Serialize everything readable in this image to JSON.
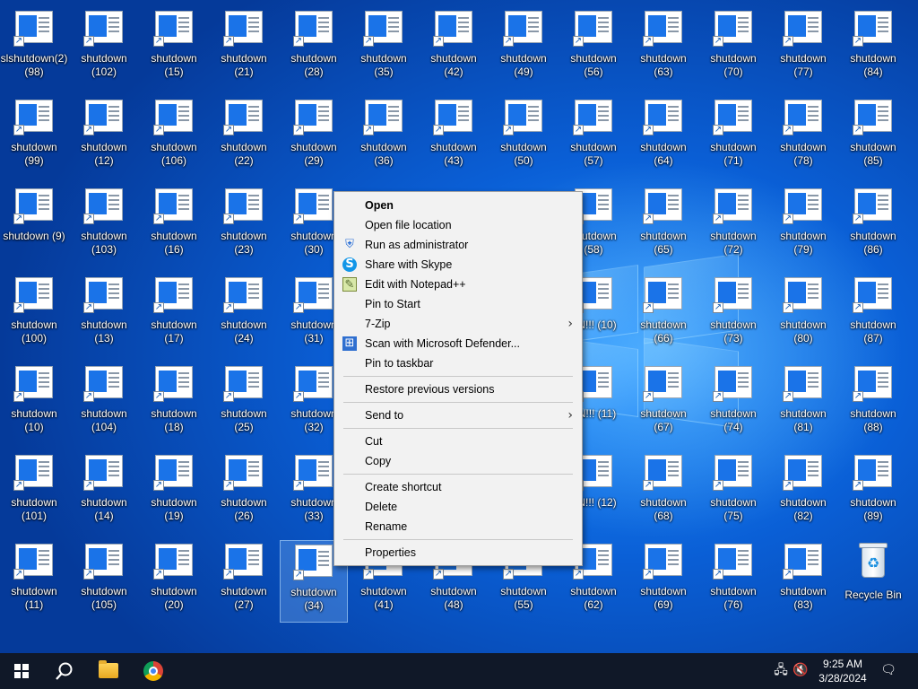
{
  "desktop": {
    "icon_label_base": "shutdown",
    "columns": [
      [
        "(98)",
        "(99)",
        "(9)",
        "(100)",
        "(10)",
        "(101)",
        "(11)"
      ],
      [
        "(102)",
        "(12)",
        "(103)",
        "(13)",
        "(104)",
        "(14)",
        "(105)"
      ],
      [
        "(15)",
        "(106)",
        "(16)",
        "(17)",
        "(18)",
        "(19)",
        "(20)"
      ],
      [
        "(21)",
        "(22)",
        "(23)",
        "(24)",
        "(25)",
        "(26)",
        "(27)"
      ],
      [
        "(28)",
        "(29)",
        "(30)",
        "(31)",
        "(32)",
        "(33)",
        "(34)"
      ],
      [
        "(35)",
        "(36)",
        "",
        "",
        "",
        "",
        "(41)"
      ],
      [
        "(42)",
        "(43)",
        "",
        "",
        "",
        "",
        "(48)"
      ],
      [
        "(49)",
        "(50)",
        "",
        "",
        "",
        "",
        "(55)"
      ],
      [
        "(56)",
        "(57)",
        "(58)",
        "EN!!! (10)",
        "EN!!! (11)",
        "EN!!! (12)",
        "(62)"
      ],
      [
        "(63)",
        "(64)",
        "(65)",
        "(66)",
        "(67)",
        "(68)",
        "(69)"
      ],
      [
        "(70)",
        "(71)",
        "(72)",
        "(73)",
        "(74)",
        "(75)",
        "(76)"
      ],
      [
        "(77)",
        "(78)",
        "(79)",
        "(80)",
        "(81)",
        "(82)",
        "(83)"
      ],
      [
        "(84)",
        "(85)",
        "(86)",
        "(87)",
        "(88)",
        "(89)",
        "recycle"
      ]
    ],
    "first_icon_overlap_label": "slshutdown(2)",
    "recycle_bin_label": "Recycle Bin",
    "selected_icon": "shutdown (34)"
  },
  "context_menu": {
    "items": [
      {
        "label": "Open",
        "bold": true,
        "icon": "",
        "submenu": false
      },
      {
        "label": "Open file location",
        "icon": "",
        "submenu": false
      },
      {
        "label": "Run as administrator",
        "icon": "uac-shield-icon",
        "submenu": false
      },
      {
        "label": "Share with Skype",
        "icon": "skype-icon",
        "submenu": false
      },
      {
        "label": "Edit with Notepad++",
        "icon": "notepad-plus-plus-icon",
        "submenu": false
      },
      {
        "label": "Pin to Start",
        "icon": "",
        "submenu": false
      },
      {
        "label": "7-Zip",
        "icon": "",
        "submenu": true
      },
      {
        "label": "Scan with Microsoft Defender...",
        "icon": "defender-icon",
        "submenu": false
      },
      {
        "label": "Pin to taskbar",
        "icon": "",
        "submenu": false
      },
      {
        "separator": true
      },
      {
        "label": "Restore previous versions",
        "icon": "",
        "submenu": false
      },
      {
        "separator": true
      },
      {
        "label": "Send to",
        "icon": "",
        "submenu": true
      },
      {
        "separator": true
      },
      {
        "label": "Cut",
        "icon": "",
        "submenu": false
      },
      {
        "label": "Copy",
        "icon": "",
        "submenu": false
      },
      {
        "separator": true
      },
      {
        "label": "Create shortcut",
        "icon": "",
        "submenu": false
      },
      {
        "label": "Delete",
        "icon": "",
        "submenu": false
      },
      {
        "label": "Rename",
        "icon": "",
        "submenu": false
      },
      {
        "separator": true
      },
      {
        "label": "Properties",
        "icon": "",
        "submenu": false
      }
    ]
  },
  "taskbar": {
    "time": "9:25 AM",
    "date": "3/28/2024",
    "pinned": [
      "windows-start-icon",
      "search-icon",
      "file-explorer-icon",
      "chrome-icon"
    ],
    "tray": [
      "network-icon",
      "volume-muted-icon",
      "notifications-icon"
    ]
  }
}
